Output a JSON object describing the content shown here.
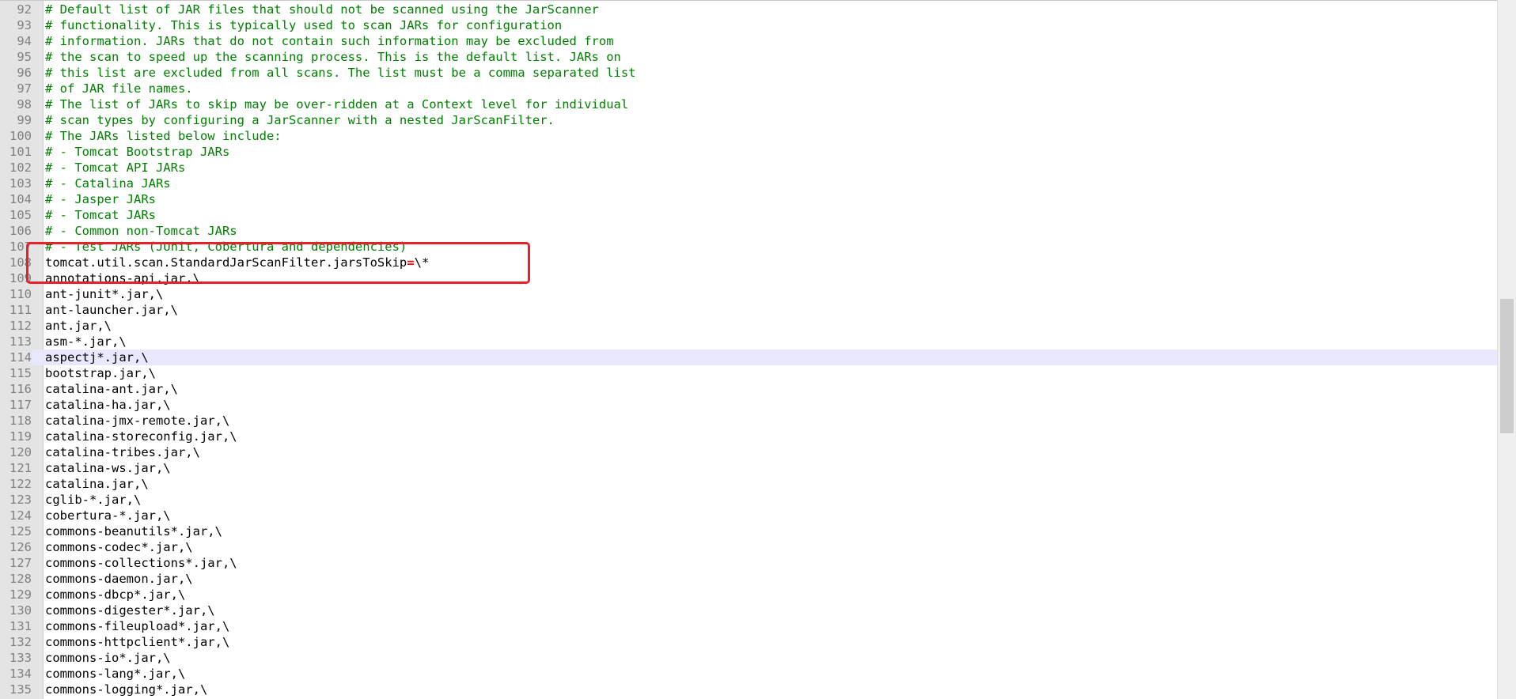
{
  "editor": {
    "lines": [
      {
        "num": "92",
        "text": "# Default list of JAR files that should not be scanned using the JarScanner",
        "kind": "comment"
      },
      {
        "num": "93",
        "text": "# functionality. This is typically used to scan JARs for configuration",
        "kind": "comment"
      },
      {
        "num": "94",
        "text": "# information. JARs that do not contain such information may be excluded from",
        "kind": "comment"
      },
      {
        "num": "95",
        "text": "# the scan to speed up the scanning process. This is the default list. JARs on",
        "kind": "comment"
      },
      {
        "num": "96",
        "text": "# this list are excluded from all scans. The list must be a comma separated list",
        "kind": "comment"
      },
      {
        "num": "97",
        "text": "# of JAR file names.",
        "kind": "comment"
      },
      {
        "num": "98",
        "text": "# The list of JARs to skip may be over-ridden at a Context level for individual",
        "kind": "comment"
      },
      {
        "num": "99",
        "text": "# scan types by configuring a JarScanner with a nested JarScanFilter.",
        "kind": "comment"
      },
      {
        "num": "100",
        "text": "# The JARs listed below include:",
        "kind": "comment"
      },
      {
        "num": "101",
        "text": "# - Tomcat Bootstrap JARs",
        "kind": "comment"
      },
      {
        "num": "102",
        "text": "# - Tomcat API JARs",
        "kind": "comment"
      },
      {
        "num": "103",
        "text": "# - Catalina JARs",
        "kind": "comment"
      },
      {
        "num": "104",
        "text": "# - Jasper JARs",
        "kind": "comment"
      },
      {
        "num": "105",
        "text": "# - Tomcat JARs",
        "kind": "comment"
      },
      {
        "num": "106",
        "text": "# - Common non-Tomcat JARs",
        "kind": "comment"
      },
      {
        "num": "107",
        "text": "# - Test JARs (JUnit, Cobertura and dependencies)",
        "kind": "comment"
      },
      {
        "num": "108",
        "kind": "property",
        "key": "tomcat.util.scan.StandardJarScanFilter.jarsToSkip",
        "op": "=",
        "value": "\\*"
      },
      {
        "num": "109",
        "text": "annotations-api.jar,\\",
        "kind": "plain"
      },
      {
        "num": "110",
        "text": "ant-junit*.jar,\\",
        "kind": "plain"
      },
      {
        "num": "111",
        "text": "ant-launcher.jar,\\",
        "kind": "plain"
      },
      {
        "num": "112",
        "text": "ant.jar,\\",
        "kind": "plain"
      },
      {
        "num": "113",
        "text": "asm-*.jar,\\",
        "kind": "plain"
      },
      {
        "num": "114",
        "text": "aspectj*.jar,\\",
        "kind": "plain",
        "current": true
      },
      {
        "num": "115",
        "text": "bootstrap.jar,\\",
        "kind": "plain"
      },
      {
        "num": "116",
        "text": "catalina-ant.jar,\\",
        "kind": "plain"
      },
      {
        "num": "117",
        "text": "catalina-ha.jar,\\",
        "kind": "plain"
      },
      {
        "num": "118",
        "text": "catalina-jmx-remote.jar,\\",
        "kind": "plain"
      },
      {
        "num": "119",
        "text": "catalina-storeconfig.jar,\\",
        "kind": "plain"
      },
      {
        "num": "120",
        "text": "catalina-tribes.jar,\\",
        "kind": "plain"
      },
      {
        "num": "121",
        "text": "catalina-ws.jar,\\",
        "kind": "plain"
      },
      {
        "num": "122",
        "text": "catalina.jar,\\",
        "kind": "plain"
      },
      {
        "num": "123",
        "text": "cglib-*.jar,\\",
        "kind": "plain"
      },
      {
        "num": "124",
        "text": "cobertura-*.jar,\\",
        "kind": "plain"
      },
      {
        "num": "125",
        "text": "commons-beanutils*.jar,\\",
        "kind": "plain"
      },
      {
        "num": "126",
        "text": "commons-codec*.jar,\\",
        "kind": "plain"
      },
      {
        "num": "127",
        "text": "commons-collections*.jar,\\",
        "kind": "plain"
      },
      {
        "num": "128",
        "text": "commons-daemon.jar,\\",
        "kind": "plain"
      },
      {
        "num": "129",
        "text": "commons-dbcp*.jar,\\",
        "kind": "plain"
      },
      {
        "num": "130",
        "text": "commons-digester*.jar,\\",
        "kind": "plain"
      },
      {
        "num": "131",
        "text": "commons-fileupload*.jar,\\",
        "kind": "plain"
      },
      {
        "num": "132",
        "text": "commons-httpclient*.jar,\\",
        "kind": "plain"
      },
      {
        "num": "133",
        "text": "commons-io*.jar,\\",
        "kind": "plain"
      },
      {
        "num": "134",
        "text": "commons-lang*.jar,\\",
        "kind": "plain"
      },
      {
        "num": "135",
        "text": "commons-logging*.jar,\\",
        "kind": "plain"
      }
    ]
  },
  "colors": {
    "comment": "#008000",
    "operator": "#ff0000",
    "highlight_box": "#e8202a",
    "current_line": "#e8e8ff",
    "gutter": "#e4e4e4",
    "line_number": "#808080"
  }
}
